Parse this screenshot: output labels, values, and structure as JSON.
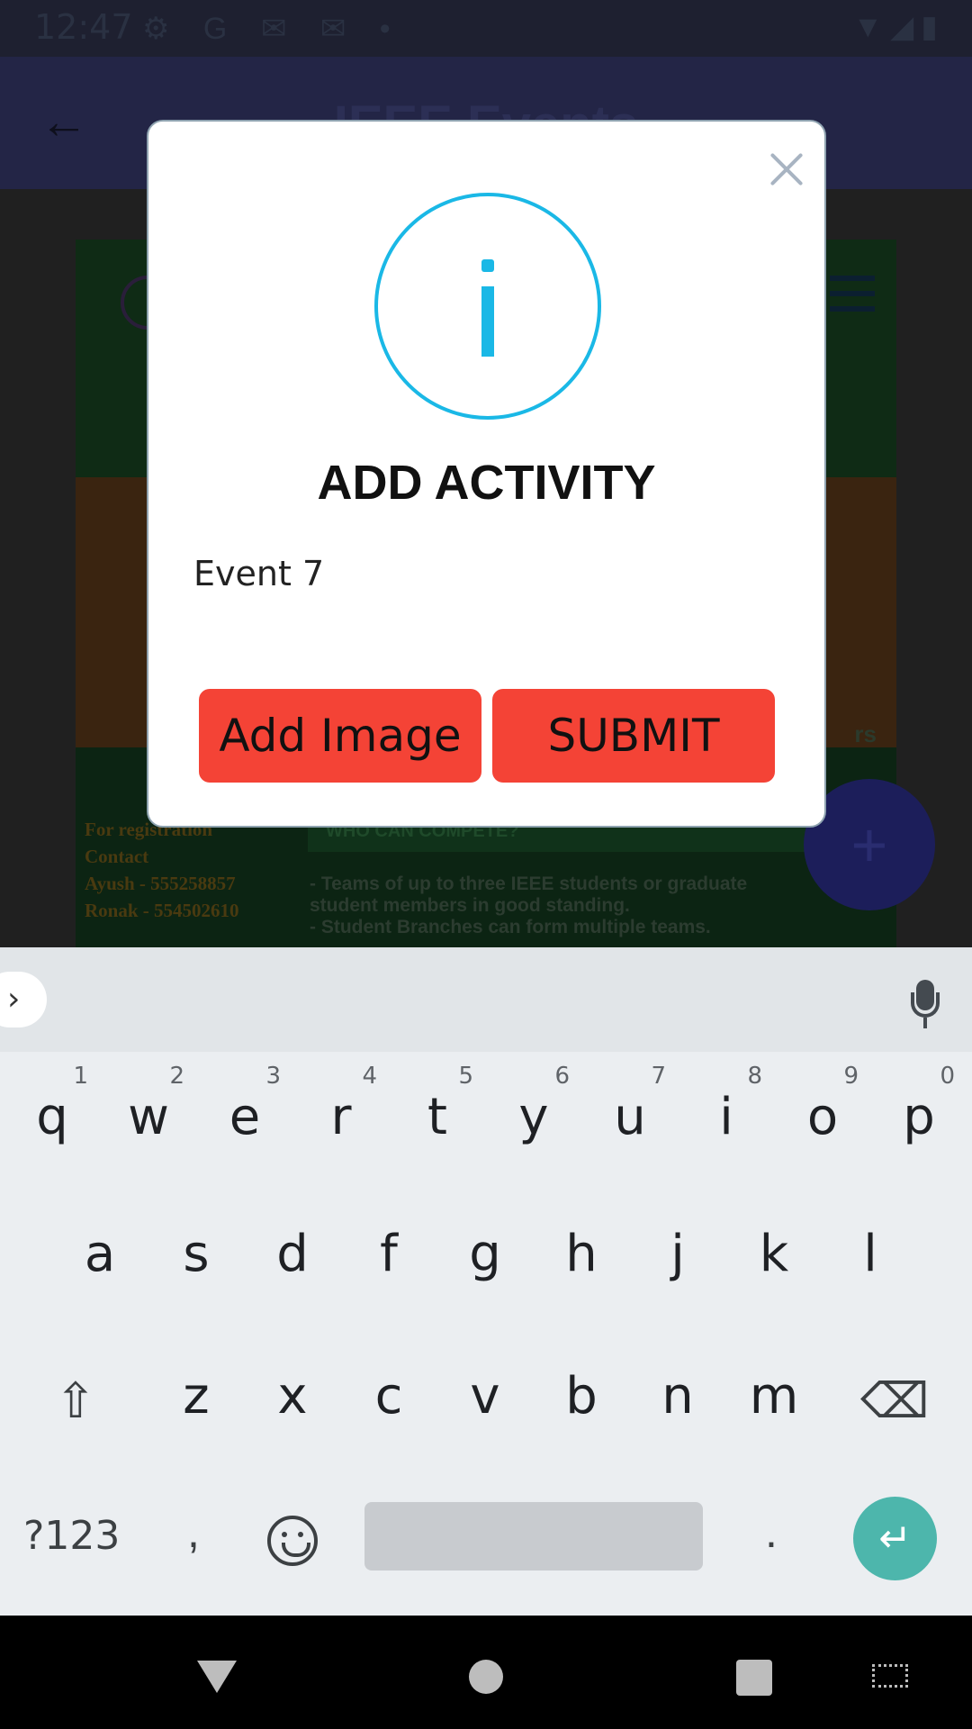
{
  "status_bar": {
    "time": "12:47"
  },
  "app_bar": {
    "title": "IEEE Events",
    "back_icon": "arrow-left-icon"
  },
  "poster": {
    "side_text": "rs",
    "registration_lines": [
      "For registration",
      "Contact",
      "Ayush - 555258857",
      "Ronak - 554502610"
    ],
    "compete_heading": "WHO CAN COMPETE?",
    "teams_lines": [
      "- Teams of up to three IEEE students or graduate",
      "student members in good standing.",
      "- Student Branches can form multiple teams."
    ]
  },
  "dialog": {
    "icon": "info-icon",
    "accent_color": "#1ab8e6",
    "title": "ADD ACTIVITY",
    "input_value": "Event 7",
    "add_image_label": "Add Image",
    "submit_label": "SUBMIT",
    "button_color": "#f44336"
  },
  "keyboard": {
    "row1": [
      {
        "key": "q",
        "hint": "1"
      },
      {
        "key": "w",
        "hint": "2"
      },
      {
        "key": "e",
        "hint": "3"
      },
      {
        "key": "r",
        "hint": "4"
      },
      {
        "key": "t",
        "hint": "5"
      },
      {
        "key": "y",
        "hint": "6"
      },
      {
        "key": "u",
        "hint": "7"
      },
      {
        "key": "i",
        "hint": "8"
      },
      {
        "key": "o",
        "hint": "9"
      },
      {
        "key": "p",
        "hint": "0"
      }
    ],
    "row2": [
      "a",
      "s",
      "d",
      "f",
      "g",
      "h",
      "j",
      "k",
      "l"
    ],
    "row3": [
      "z",
      "x",
      "c",
      "v",
      "b",
      "n",
      "m"
    ],
    "symbols_label": "?123",
    "comma": ",",
    "period": ".",
    "enter_color": "#4db6ac"
  }
}
